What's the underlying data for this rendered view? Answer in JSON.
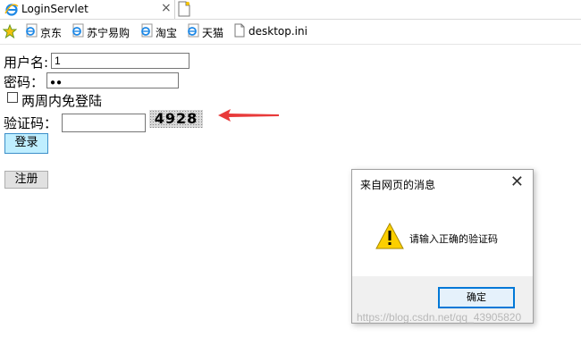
{
  "browser": {
    "tab": {
      "title": "LoginServlet",
      "icon": "ie-icon"
    },
    "favorites": [
      {
        "label": "京东",
        "icon": "ie-icon"
      },
      {
        "label": "苏宁易购",
        "icon": "ie-icon"
      },
      {
        "label": "淘宝",
        "icon": "ie-icon"
      },
      {
        "label": "天猫",
        "icon": "ie-icon"
      },
      {
        "label": "desktop.ini",
        "icon": "file-icon"
      }
    ]
  },
  "form": {
    "username_label": "用户名:",
    "username_value": "1",
    "password_label": "密码：",
    "password_mask": "●●",
    "remember_label": "两周内免登陆",
    "remember_checked": false,
    "captcha_label": "验证码：",
    "captcha_value": "",
    "captcha_image_text": "4928",
    "login_label": "登录",
    "register_label": "注册"
  },
  "dialog": {
    "title": "来自网页的消息",
    "message": "请输入正确的验证码",
    "ok_label": "确定"
  },
  "watermark": "https://blog.csdn.net/qq_43905820",
  "colors": {
    "arrow": "#e83a3a",
    "login_button_bg": "#bfeeff",
    "dialog_ok_border": "#0078d7"
  }
}
